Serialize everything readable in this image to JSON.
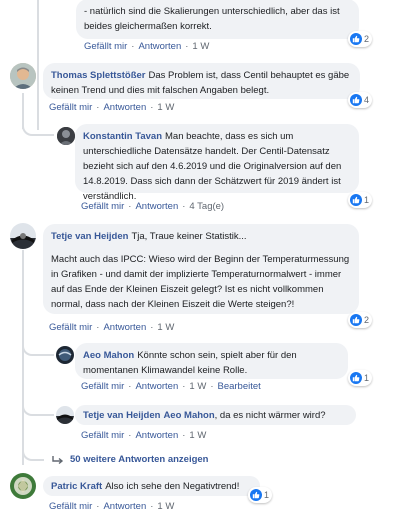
{
  "comments": [
    {
      "text": "- natürlich sind die Skalierungen unterschiedlich, aber das ist beides gleichermaßen korrekt.",
      "like": "Gefällt mir",
      "reply": "Antworten",
      "time": "1 W",
      "reactions": "2"
    },
    {
      "author": "Thomas Splettstößer",
      "text": "Das Problem ist, dass Centil behauptet es gäbe keinen Trend und dies mit falschen Angaben belegt.",
      "like": "Gefällt mir",
      "reply": "Antworten",
      "time": "1 W",
      "reactions": "4"
    },
    {
      "author": "Konstantin Tavan",
      "text": "Man beachte, dass es sich um unterschiedliche Datensätze handelt. Der Centil-Datensatz bezieht sich auf den 4.6.2019 und die Originalversion auf den 14.8.2019. Dass sich dann der Schätzwert für 2019 ändert ist verständlich.",
      "like": "Gefällt mir",
      "reply": "Antworten",
      "time": "4 Tag(e)",
      "reactions": "1"
    },
    {
      "author": "Tetje van Heijden",
      "text_line1": "Tja, Traue keiner Statistik...",
      "text_rest": "Macht auch das IPCC: Wieso wird der Beginn der Temperaturmessung in Grafiken - und damit der implizierte Temperaturnormalwert - immer auf das Ende der Kleinen Eiszeit gelegt? Ist es nicht vollkommen normal, dass nach der Kleinen Eiszeit die Werte steigen?!",
      "like": "Gefällt mir",
      "reply": "Antworten",
      "time": "1 W",
      "reactions": "2"
    },
    {
      "author": "Aeo Mahon",
      "text": "Könnte schon sein, spielt aber für den momentanen Klimawandel keine Rolle.",
      "like": "Gefällt mir",
      "reply": "Antworten",
      "time": "1 W",
      "edited": "Bearbeitet",
      "reactions": "1"
    },
    {
      "author": "Tetje van Heijden",
      "mention": "Aeo Mahon",
      "text": ", da es nicht wärmer wird?",
      "like": "Gefällt mir",
      "reply": "Antworten",
      "time": "1 W"
    },
    {
      "author": "Patric Kraft",
      "text": "Also ich sehe den Negativtrend!",
      "like": "Gefällt mir",
      "reply": "Antworten",
      "time": "1 W",
      "reactions": "1"
    }
  ],
  "more_replies": "50 weitere Antworten anzeigen",
  "colors": {
    "link": "#385898",
    "bubble": "#f0f2f5",
    "like": "#1877f2",
    "meta": "#606770"
  },
  "icons": {
    "reaction": "thumbs-up-icon",
    "more_replies": "reply-arrow-icon"
  }
}
